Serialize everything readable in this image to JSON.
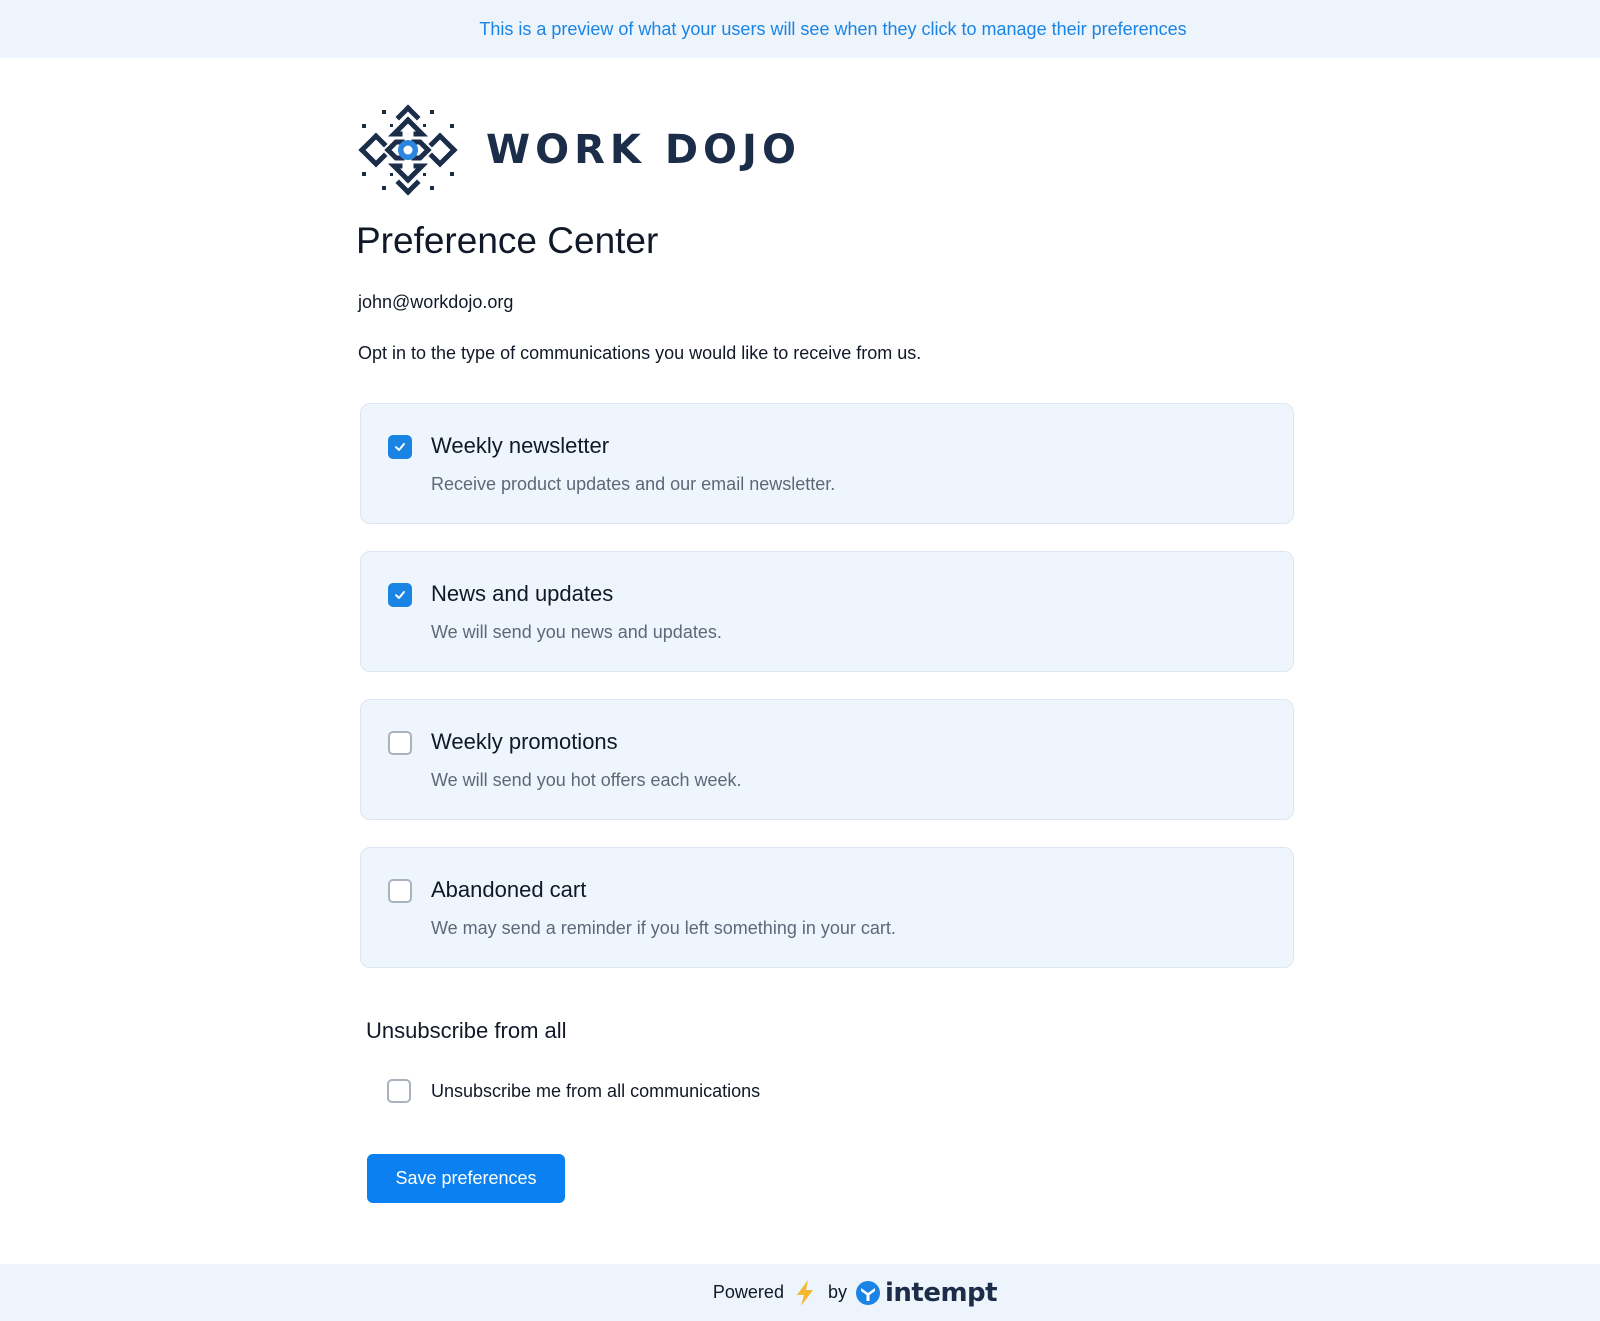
{
  "banner": {
    "text": "This is a preview of what your users will see when they click to manage their preferences"
  },
  "brand": {
    "name": "WORK DOJO",
    "logo_icon": "work-dojo-logo-icon"
  },
  "page": {
    "title": "Preference Center",
    "email": "john@workdojo.org",
    "intro": "Opt in to the type of communications you would like to receive from us."
  },
  "preferences": [
    {
      "title": "Weekly newsletter",
      "description": "Receive product updates and our email newsletter.",
      "checked": true
    },
    {
      "title": "News and updates",
      "description": "We will send you news and updates.",
      "checked": true
    },
    {
      "title": "Weekly promotions",
      "description": "We will send you hot offers each week.",
      "checked": false
    },
    {
      "title": "Abandoned cart",
      "description": "We may send a reminder if you left something in your cart.",
      "checked": false
    }
  ],
  "unsubscribe": {
    "title": "Unsubscribe from all",
    "label": "Unsubscribe me from all communications",
    "checked": false
  },
  "actions": {
    "save_label": "Save preferences"
  },
  "footer": {
    "powered": "Powered",
    "by": "by",
    "vendor": "intempt",
    "bolt_icon": "lightning-bolt-icon"
  },
  "colors": {
    "accent": "#1a84e5",
    "button": "#0b80f0",
    "card_bg": "#eff5fc",
    "banner_bg": "#eef4fb",
    "brand_navy": "#1b2d48",
    "bolt": "#f5b82e"
  }
}
